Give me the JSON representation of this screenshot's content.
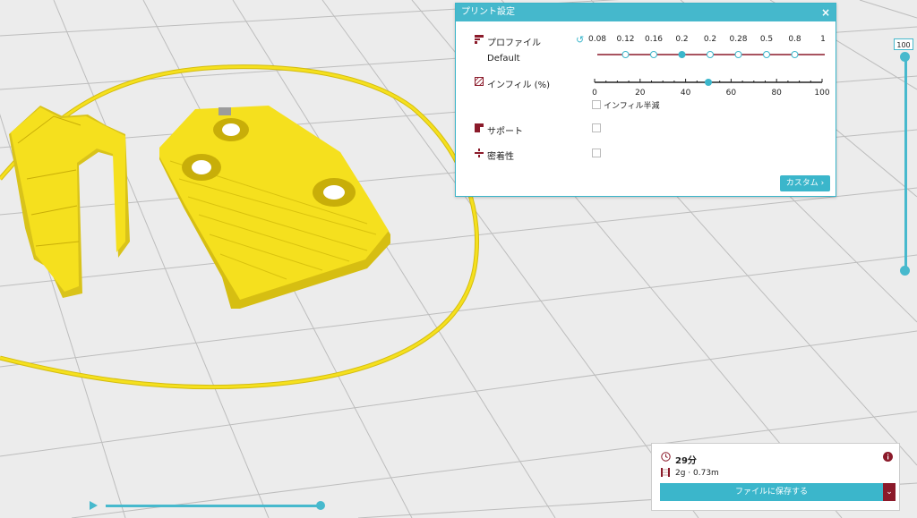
{
  "panel": {
    "title": "プリント設定",
    "close": "×",
    "profile_label": "プロファイル",
    "profile_value": "Default",
    "profile_ticks": [
      "0.08",
      "0.12",
      "0.16",
      "0.2",
      "0.2",
      "0.28",
      "0.5",
      "0.8",
      "1"
    ],
    "profile_selected_index": 3,
    "infill_label": "インフィル (%)",
    "infill_ticks": [
      "0",
      "20",
      "40",
      "60",
      "80",
      "100"
    ],
    "infill_value_percent": 50,
    "gradual_infill_label": "インフィル半減",
    "support_label": "サポート",
    "adhesion_label": "密着性",
    "custom_label": "カスタム"
  },
  "layer_slider": {
    "value": "100"
  },
  "job": {
    "time": "29分",
    "material": "2g · 0.73m",
    "save_label": "ファイルに保存する",
    "dropdown_icon": "chevron-down-icon"
  },
  "colors": {
    "accent": "#47b9cd",
    "model": "#f5e01e",
    "profile_track": "#8b1a2a"
  }
}
